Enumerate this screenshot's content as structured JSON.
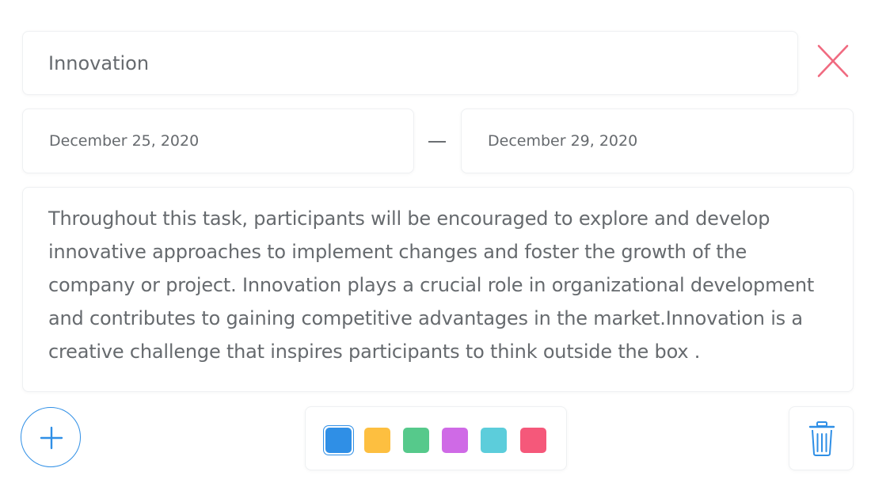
{
  "task": {
    "title": "Innovation",
    "start_date": "December 25, 2020",
    "end_date": "December 29, 2020",
    "description": "Throughout this task, participants will be encouraged to explore and develop innovative approaches to implement changes and foster the growth of the company or project. Innovation plays a crucial role in organizational development and contributes to gaining competitive advantages in the market.Innovation is a creative challenge that inspires participants to think outside the box ."
  },
  "icons": {
    "close": "close-icon",
    "add": "plus-icon",
    "delete": "trash-icon"
  },
  "colors": {
    "accent": "#2f8fe6",
    "close": "#f06a80",
    "swatches": [
      "#2f8fe6",
      "#fdbf40",
      "#56c98b",
      "#cf6ae6",
      "#5ccddb",
      "#f5587a"
    ],
    "selected_index": 0
  }
}
